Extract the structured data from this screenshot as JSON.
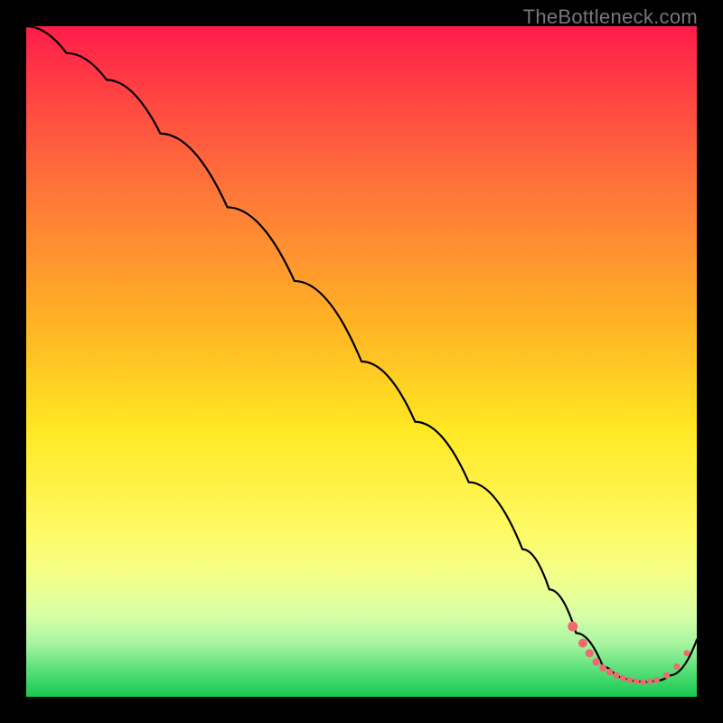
{
  "watermark": "TheBottleneck.com",
  "chart_data": {
    "type": "line",
    "title": "",
    "xlabel": "",
    "ylabel": "",
    "xlim": [
      0,
      100
    ],
    "ylim": [
      0,
      100
    ],
    "series": [
      {
        "name": "bottleneck-curve",
        "x": [
          0,
          6,
          12,
          20,
          30,
          40,
          50,
          58,
          66,
          74,
          78,
          82,
          86,
          88,
          90,
          92,
          94,
          96,
          100
        ],
        "y": [
          100,
          96,
          92,
          84,
          73,
          62,
          50,
          41,
          32,
          22,
          16,
          9.5,
          4.5,
          3.0,
          2.4,
          2.2,
          2.4,
          3.2,
          8.5
        ]
      }
    ],
    "markers": {
      "name": "highlighted-range",
      "color": "#f06a6f",
      "points_x": [
        81.5,
        83,
        84,
        85,
        86,
        87,
        88,
        89,
        90,
        91,
        92,
        93,
        94,
        95.5,
        97,
        98.5
      ],
      "points_y": [
        10.5,
        8.0,
        6.5,
        5.2,
        4.3,
        3.7,
        3.2,
        2.8,
        2.5,
        2.3,
        2.2,
        2.3,
        2.5,
        3.2,
        4.5,
        6.5
      ],
      "points_r": [
        5.5,
        5.0,
        4.6,
        4.3,
        4.0,
        3.8,
        3.6,
        3.5,
        3.4,
        3.3,
        3.2,
        3.3,
        3.4,
        3.6,
        3.5,
        3.4
      ]
    }
  }
}
